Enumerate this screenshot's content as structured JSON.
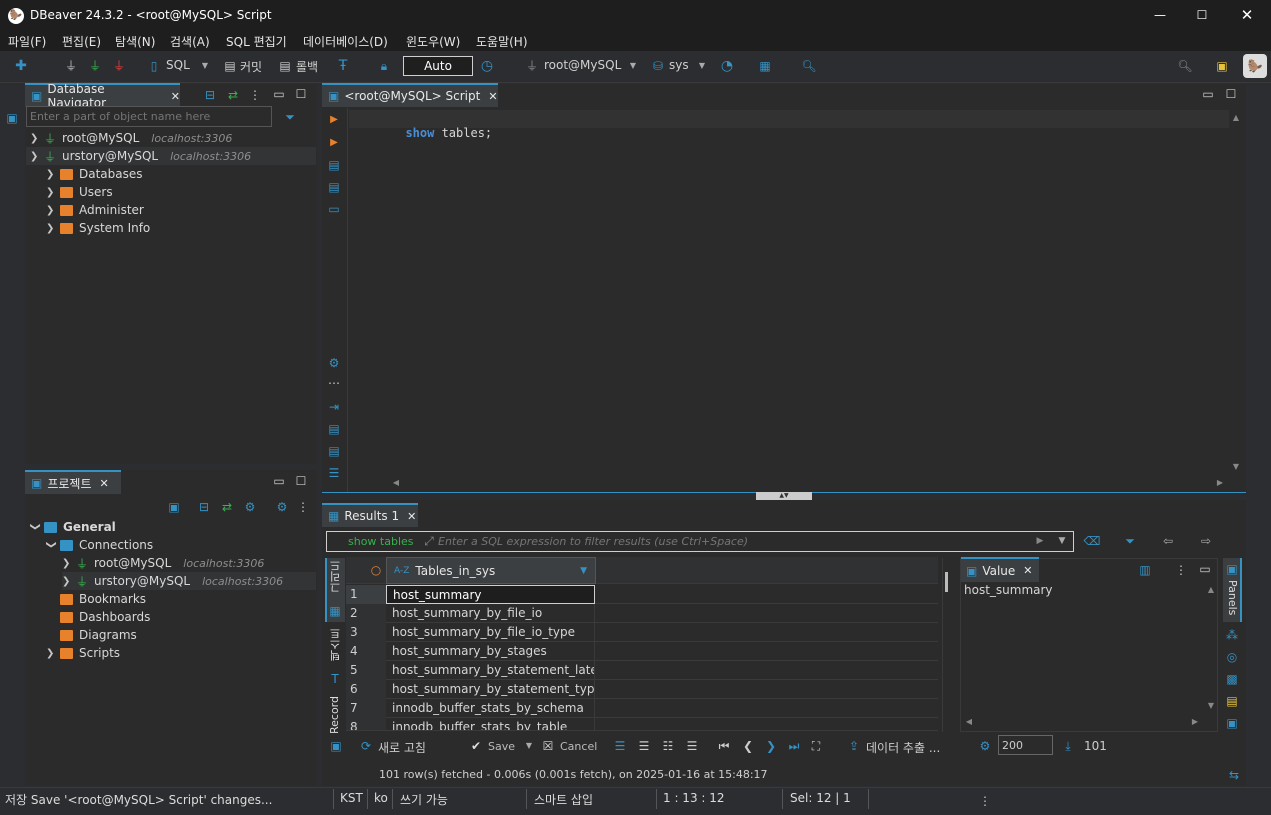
{
  "window": {
    "title": "DBeaver 24.3.2 - <root@MySQL> Script"
  },
  "menu": [
    "파일(F)",
    "편집(E)",
    "탐색(N)",
    "검색(A)",
    "SQL 편집기",
    "데이터베이스(D)",
    "윈도우(W)",
    "도움말(H)"
  ],
  "toolbar": {
    "sql": "SQL",
    "commit": "커밋",
    "rollback": "롤백",
    "auto": "Auto",
    "connection": "root@MySQL",
    "schema": "sys"
  },
  "navigator": {
    "tab": "Database Navigator",
    "filter_placeholder": "Enter a part of object name here",
    "connections": [
      {
        "name": "root@MySQL",
        "host": "localhost:3306"
      },
      {
        "name": "urstory@MySQL",
        "host": "localhost:3306"
      }
    ],
    "children": [
      "Databases",
      "Users",
      "Administer",
      "System Info"
    ]
  },
  "projects": {
    "tab": "프로젝트",
    "root": "General",
    "connections_label": "Connections",
    "connections": [
      {
        "name": "root@MySQL",
        "host": "localhost:3306"
      },
      {
        "name": "urstory@MySQL",
        "host": "localhost:3306"
      }
    ],
    "folders": [
      "Bookmarks",
      "Dashboards",
      "Diagrams",
      "Scripts"
    ]
  },
  "editor": {
    "tab": "<root@MySQL> Script",
    "keyword": "show",
    "rest": " tables;"
  },
  "results": {
    "tab": "Results 1",
    "filter_label": "show tables",
    "filter_placeholder": "Enter a SQL expression to filter results (use Ctrl+Space)",
    "column": "Tables_in_sys",
    "column_type": "A-Z",
    "vertical_tabs": [
      "그리드",
      "텍스트",
      "Record"
    ],
    "rows": [
      {
        "n": "1",
        "v": "host_summary"
      },
      {
        "n": "2",
        "v": "host_summary_by_file_io"
      },
      {
        "n": "3",
        "v": "host_summary_by_file_io_type"
      },
      {
        "n": "4",
        "v": "host_summary_by_stages"
      },
      {
        "n": "5",
        "v": "host_summary_by_statement_latency"
      },
      {
        "n": "6",
        "v": "host_summary_by_statement_type"
      },
      {
        "n": "7",
        "v": "innodb_buffer_stats_by_schema"
      },
      {
        "n": "8",
        "v": "innodb_buffer_stats_by_table"
      }
    ],
    "value_panel": {
      "tab": "Value",
      "content": "host_summary"
    },
    "panels_label": "Panels",
    "bottom": {
      "refresh": "새로 고침",
      "save": "Save",
      "cancel": "Cancel",
      "export": "데이터 추출 ...",
      "limit": "200",
      "count": "101"
    },
    "fetch_status": "101 row(s) fetched - 0.006s (0.001s fetch), on 2025-01-16 at 15:48:17"
  },
  "status": {
    "message": "저장 Save '<root@MySQL> Script' changes...",
    "tz": "KST",
    "lang": "ko",
    "mode": "쓰기 가능",
    "insert": "스마트 삽입",
    "pos": "1 : 13 : 12",
    "sel": "Sel: 12 | 1"
  },
  "colors": {
    "accent": "#3592c4",
    "keyword": "#4a8fd6",
    "orange": "#e8812b",
    "green": "#37b24d"
  }
}
